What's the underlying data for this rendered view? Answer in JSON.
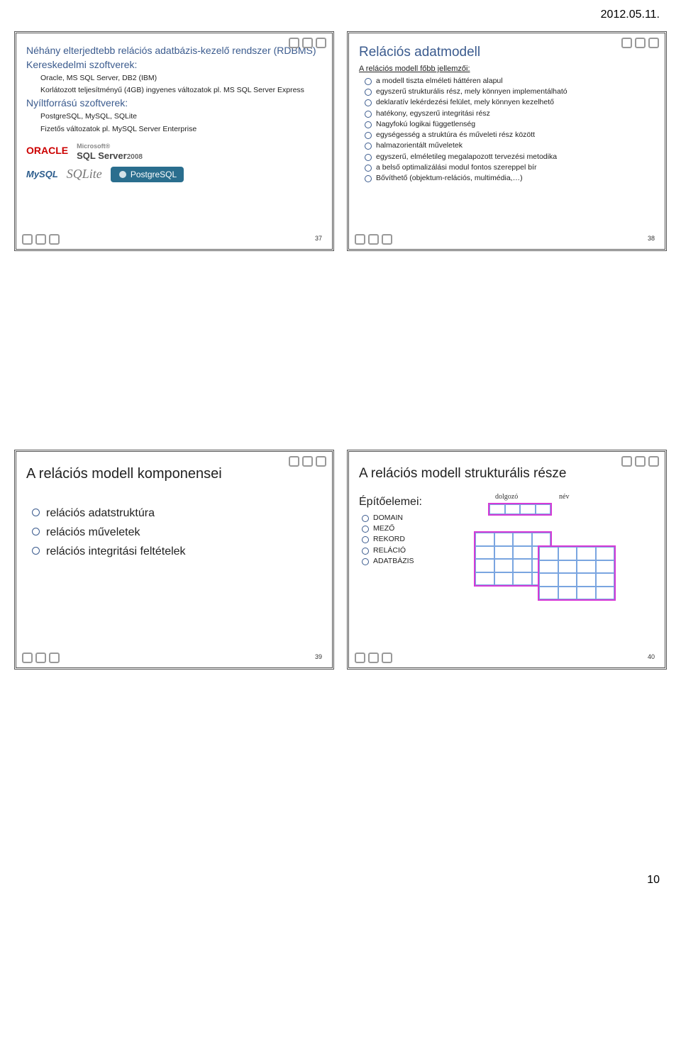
{
  "meta": {
    "date": "2012.05.11.",
    "page_number": "10"
  },
  "slides": {
    "s37": {
      "number": "37",
      "title1": "Néhány elterjedtebb relációs adatbázis-kezelő rendszer (RDBMS)",
      "sec1_title": "Kereskedelmi szoftverek:",
      "sec1_line1": "Oracle, MS SQL Server, DB2 (IBM)",
      "sec1_line2": "Korlátozott teljesítményű (4GB) ingyenes változatok pl. MS SQL Server Express",
      "sec2_title": "Nyíltforrású szoftverek:",
      "sec2_line1": "PostgreSQL, MySQL, SQLite",
      "sec2_line2": "Fizetős változatok pl. MySQL Server Enterprise",
      "logos": {
        "oracle": "ORACLE",
        "sqlserver": "SQL Server",
        "sqlserver_year": "2008",
        "mysql": "MySQL",
        "sqlite": "SQLite",
        "postgres": "PostgreSQL"
      }
    },
    "s38": {
      "number": "38",
      "title": "Relációs adatmodell",
      "subtitle": "A relációs modell főbb jellemzői:",
      "items": [
        "a modell tiszta elméleti háttéren alapul",
        "egyszerű strukturális rész, mely könnyen implementálható",
        "deklaratív lekérdezési felület, mely könnyen kezelhető",
        "hatékony, egyszerű integritási rész",
        "Nagyfokú logikai függetlenség",
        "egységesség a struktúra és műveleti rész között",
        "halmazorientált műveletek",
        "egyszerű, elméletileg megalapozott tervezési metodika",
        "a belső optimalizálási modul fontos szereppel bír",
        "Bővíthető (objektum-relációs, multimédia,…)"
      ]
    },
    "s39": {
      "number": "39",
      "title": "A relációs modell komponensei",
      "items": [
        "relációs adatstruktúra",
        "relációs műveletek",
        "relációs integritási feltételek"
      ]
    },
    "s40": {
      "number": "40",
      "title": "A relációs modell strukturális része",
      "build_title": "Építőelemei:",
      "items": [
        "DOMAIN",
        "MEZŐ",
        "REKORD",
        "RELÁCIÓ",
        "ADATBÁZIS"
      ],
      "labels": {
        "dolgozo": "dolgozó",
        "nev": "név"
      }
    }
  }
}
